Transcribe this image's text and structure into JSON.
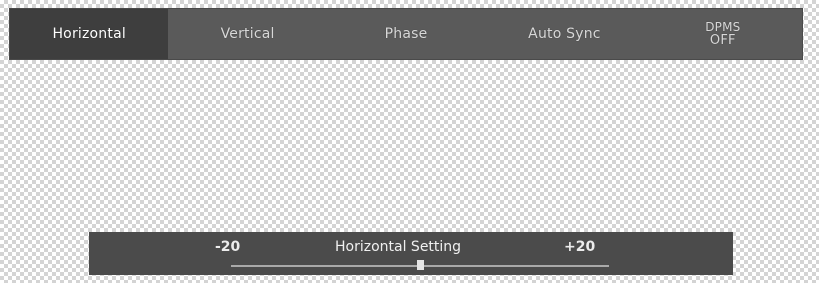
{
  "menu": {
    "tabs": [
      {
        "label": "Horizontal",
        "active": true
      },
      {
        "label": "Vertical",
        "active": false
      },
      {
        "label": "Phase",
        "active": false
      },
      {
        "label": "Auto Sync",
        "active": false
      },
      {
        "label_top": "DPMS",
        "label_bottom": "OFF",
        "active": false
      }
    ]
  },
  "setting": {
    "title": "Horizontal Setting",
    "min_label": "-20",
    "max_label": "+20",
    "min": -20,
    "max": 20,
    "value": 0
  },
  "colors": {
    "menu_background": "#5a5a5a",
    "active_tab": "#3e3e3e",
    "panel_background": "#4b4b4b"
  }
}
